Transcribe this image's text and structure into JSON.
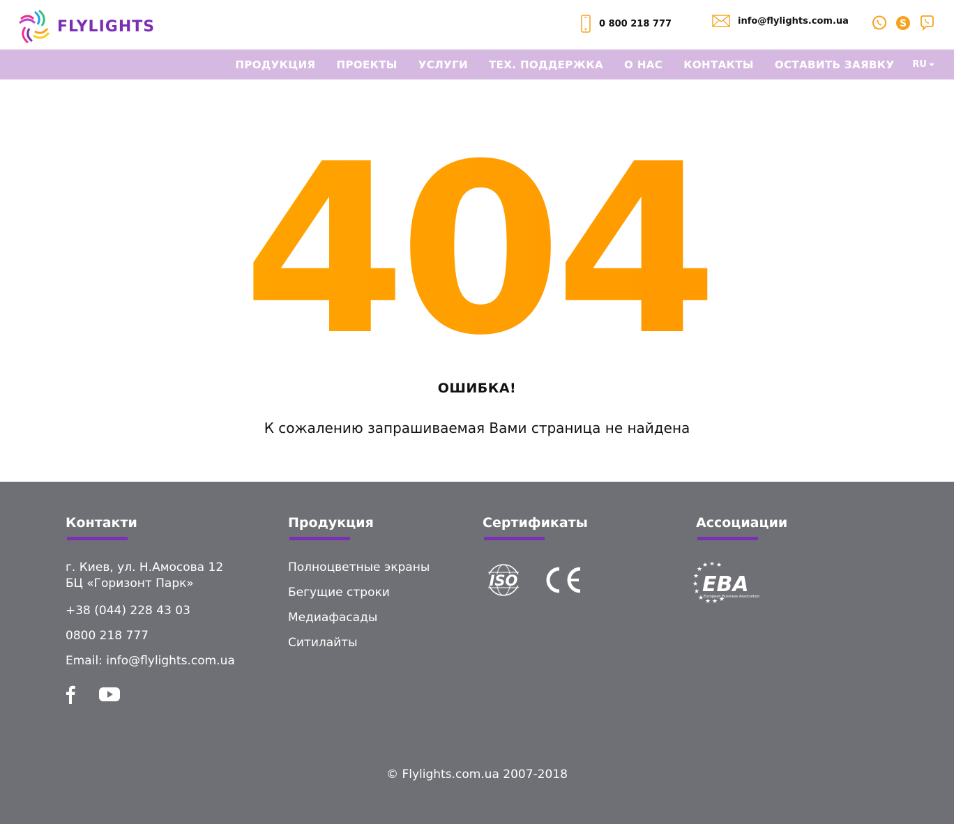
{
  "header": {
    "logo_text": "FLYLIGHTS",
    "phone": "0 800 218 777",
    "email": "info@flylights.com.ua",
    "socials": [
      "whatsapp-icon",
      "skype-icon",
      "viber-icon"
    ],
    "accent_color": "#f7a21b"
  },
  "nav": {
    "items": [
      {
        "label": "ПРОДУКЦИЯ"
      },
      {
        "label": "ПРОЕКТЫ"
      },
      {
        "label": "УСЛУГИ"
      },
      {
        "label": "ТЕХ. ПОДДЕРЖКА"
      },
      {
        "label": "О НАС"
      },
      {
        "label": "КОНТАКТЫ"
      },
      {
        "label": "ОСТАВИТЬ ЗАЯВКУ"
      }
    ],
    "language": "RU",
    "background_color": "#d6b9e1"
  },
  "main": {
    "code": "404",
    "title": "ОШИБКА!",
    "message": "К сожалению запрашиваемая Вами страница не найдена",
    "code_color": "#ffa200"
  },
  "footer": {
    "background_color": "#6f7075",
    "underline_color": "#7a2fb4",
    "contacts": {
      "title": "Контакти",
      "address_line1": "г. Киев, ул. Н.Амосова 12",
      "address_line2": "БЦ «Горизонт Парк»",
      "phone1": "+38 (044) 228 43 03",
      "phone2": "0800 218 777",
      "email": "Email: info@flylights.com.ua",
      "socials": [
        "facebook-icon",
        "youtube-icon"
      ]
    },
    "products": {
      "title": "Продукция",
      "items": [
        "Полноцветные экраны",
        "Бегущие строки",
        "Медиафасады",
        "Ситилайты"
      ]
    },
    "certificates": {
      "title": "Сертификаты",
      "logos": [
        "ISO",
        "CE"
      ]
    },
    "associations": {
      "title": "Ассоциации",
      "logo_main": "EBA",
      "logo_sub": "European Business Association"
    },
    "copyright": "© Flylights.com.ua 2007-2018"
  }
}
